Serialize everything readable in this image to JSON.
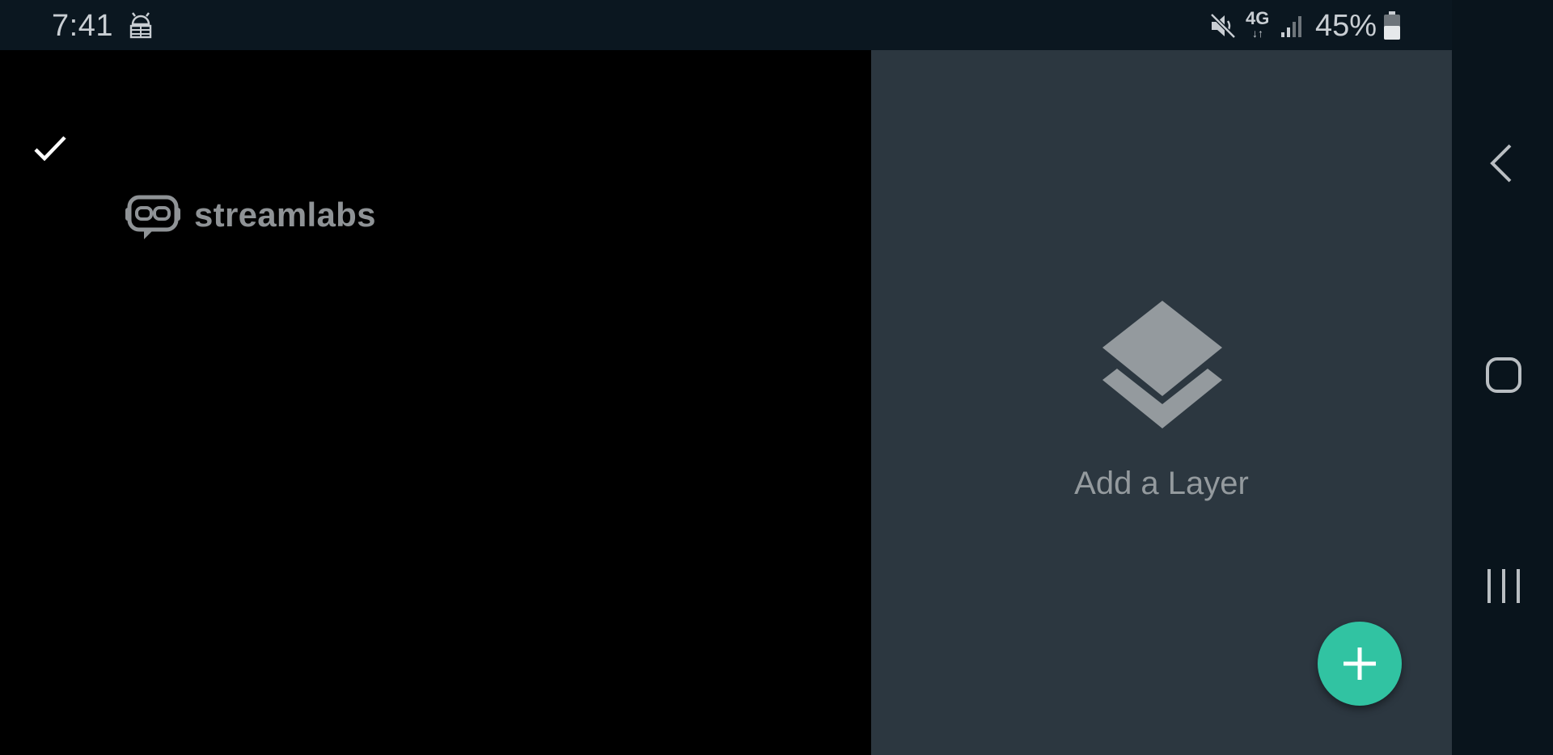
{
  "status_bar": {
    "time": "7:41",
    "network_type": "4G",
    "network_arrows": "↓↑",
    "battery_percent": "45%",
    "icons": [
      "debug-icon",
      "mute-icon",
      "signal-icon",
      "battery-icon"
    ]
  },
  "preview": {
    "brand_name": "streamlabs",
    "icons": [
      "check-icon",
      "streamlabs-logo-icon"
    ]
  },
  "layers_panel": {
    "empty_label": "Add a Layer",
    "icons": [
      "layers-icon",
      "plus-icon"
    ]
  },
  "navigation_bar": {
    "icons": [
      "back-icon",
      "home-icon",
      "recents-icon"
    ]
  },
  "colors": {
    "accent": "#31c3a2",
    "panel_bg": "#2c3740",
    "preview_bg": "#000000",
    "bar_bg": "#0b1720"
  }
}
